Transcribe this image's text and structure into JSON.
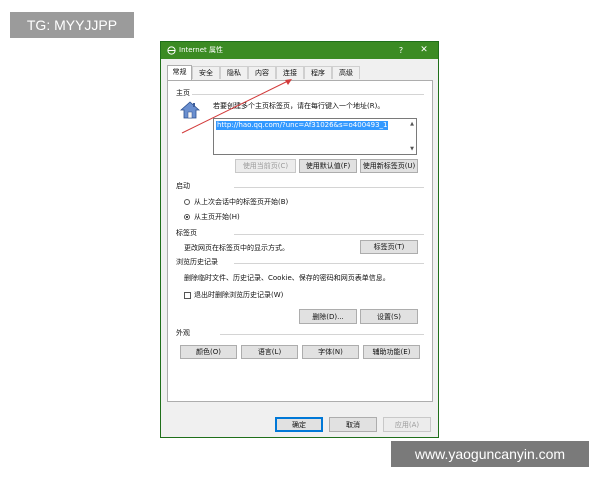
{
  "watermarks": {
    "top": "TG: MYYJJPP",
    "bottom": "www.yaoguncanyin.com"
  },
  "dialog": {
    "title": "Internet 属性",
    "help_label": "?",
    "close_label": "✕",
    "tabs": [
      {
        "label": "常规",
        "active": true
      },
      {
        "label": "安全",
        "active": false
      },
      {
        "label": "隐私",
        "active": false
      },
      {
        "label": "内容",
        "active": false
      },
      {
        "label": "连接",
        "active": false
      },
      {
        "label": "程序",
        "active": false
      },
      {
        "label": "高级",
        "active": false
      }
    ],
    "homepage": {
      "section_label": "主页",
      "description": "若要创建多个主页标签页，请在每行键入一个地址(R)。",
      "url_value": "http://hao.qq.com/?unc=Af31026&s=o400493_1",
      "buttons": {
        "use_current": "使用当前页(C)",
        "use_default": "使用默认值(F)",
        "use_new_tab": "使用新标签页(U)"
      }
    },
    "startup": {
      "section_label": "启动",
      "option_last_session": "从上次会话中的标签页开始(B)",
      "option_homepage": "从主页开始(H)",
      "selected": "option_homepage"
    },
    "tabs_section": {
      "section_label": "标签页",
      "description": "更改网页在标签页中的显示方式。",
      "button": "标签页(T)"
    },
    "history": {
      "section_label": "浏览历史记录",
      "description": "删除临时文件、历史记录、Cookie、保存的密码和网页表单信息。",
      "checkbox_label": "退出时删除浏览历史记录(W)",
      "checkbox_checked": false,
      "delete_button": "删除(D)...",
      "settings_button": "设置(S)"
    },
    "appearance": {
      "section_label": "外观",
      "colors_button": "颜色(O)",
      "languages_button": "语言(L)",
      "fonts_button": "字体(N)",
      "accessibility_button": "辅助功能(E)"
    },
    "footer": {
      "ok": "确定",
      "cancel": "取消",
      "apply": "应用(A)"
    }
  }
}
